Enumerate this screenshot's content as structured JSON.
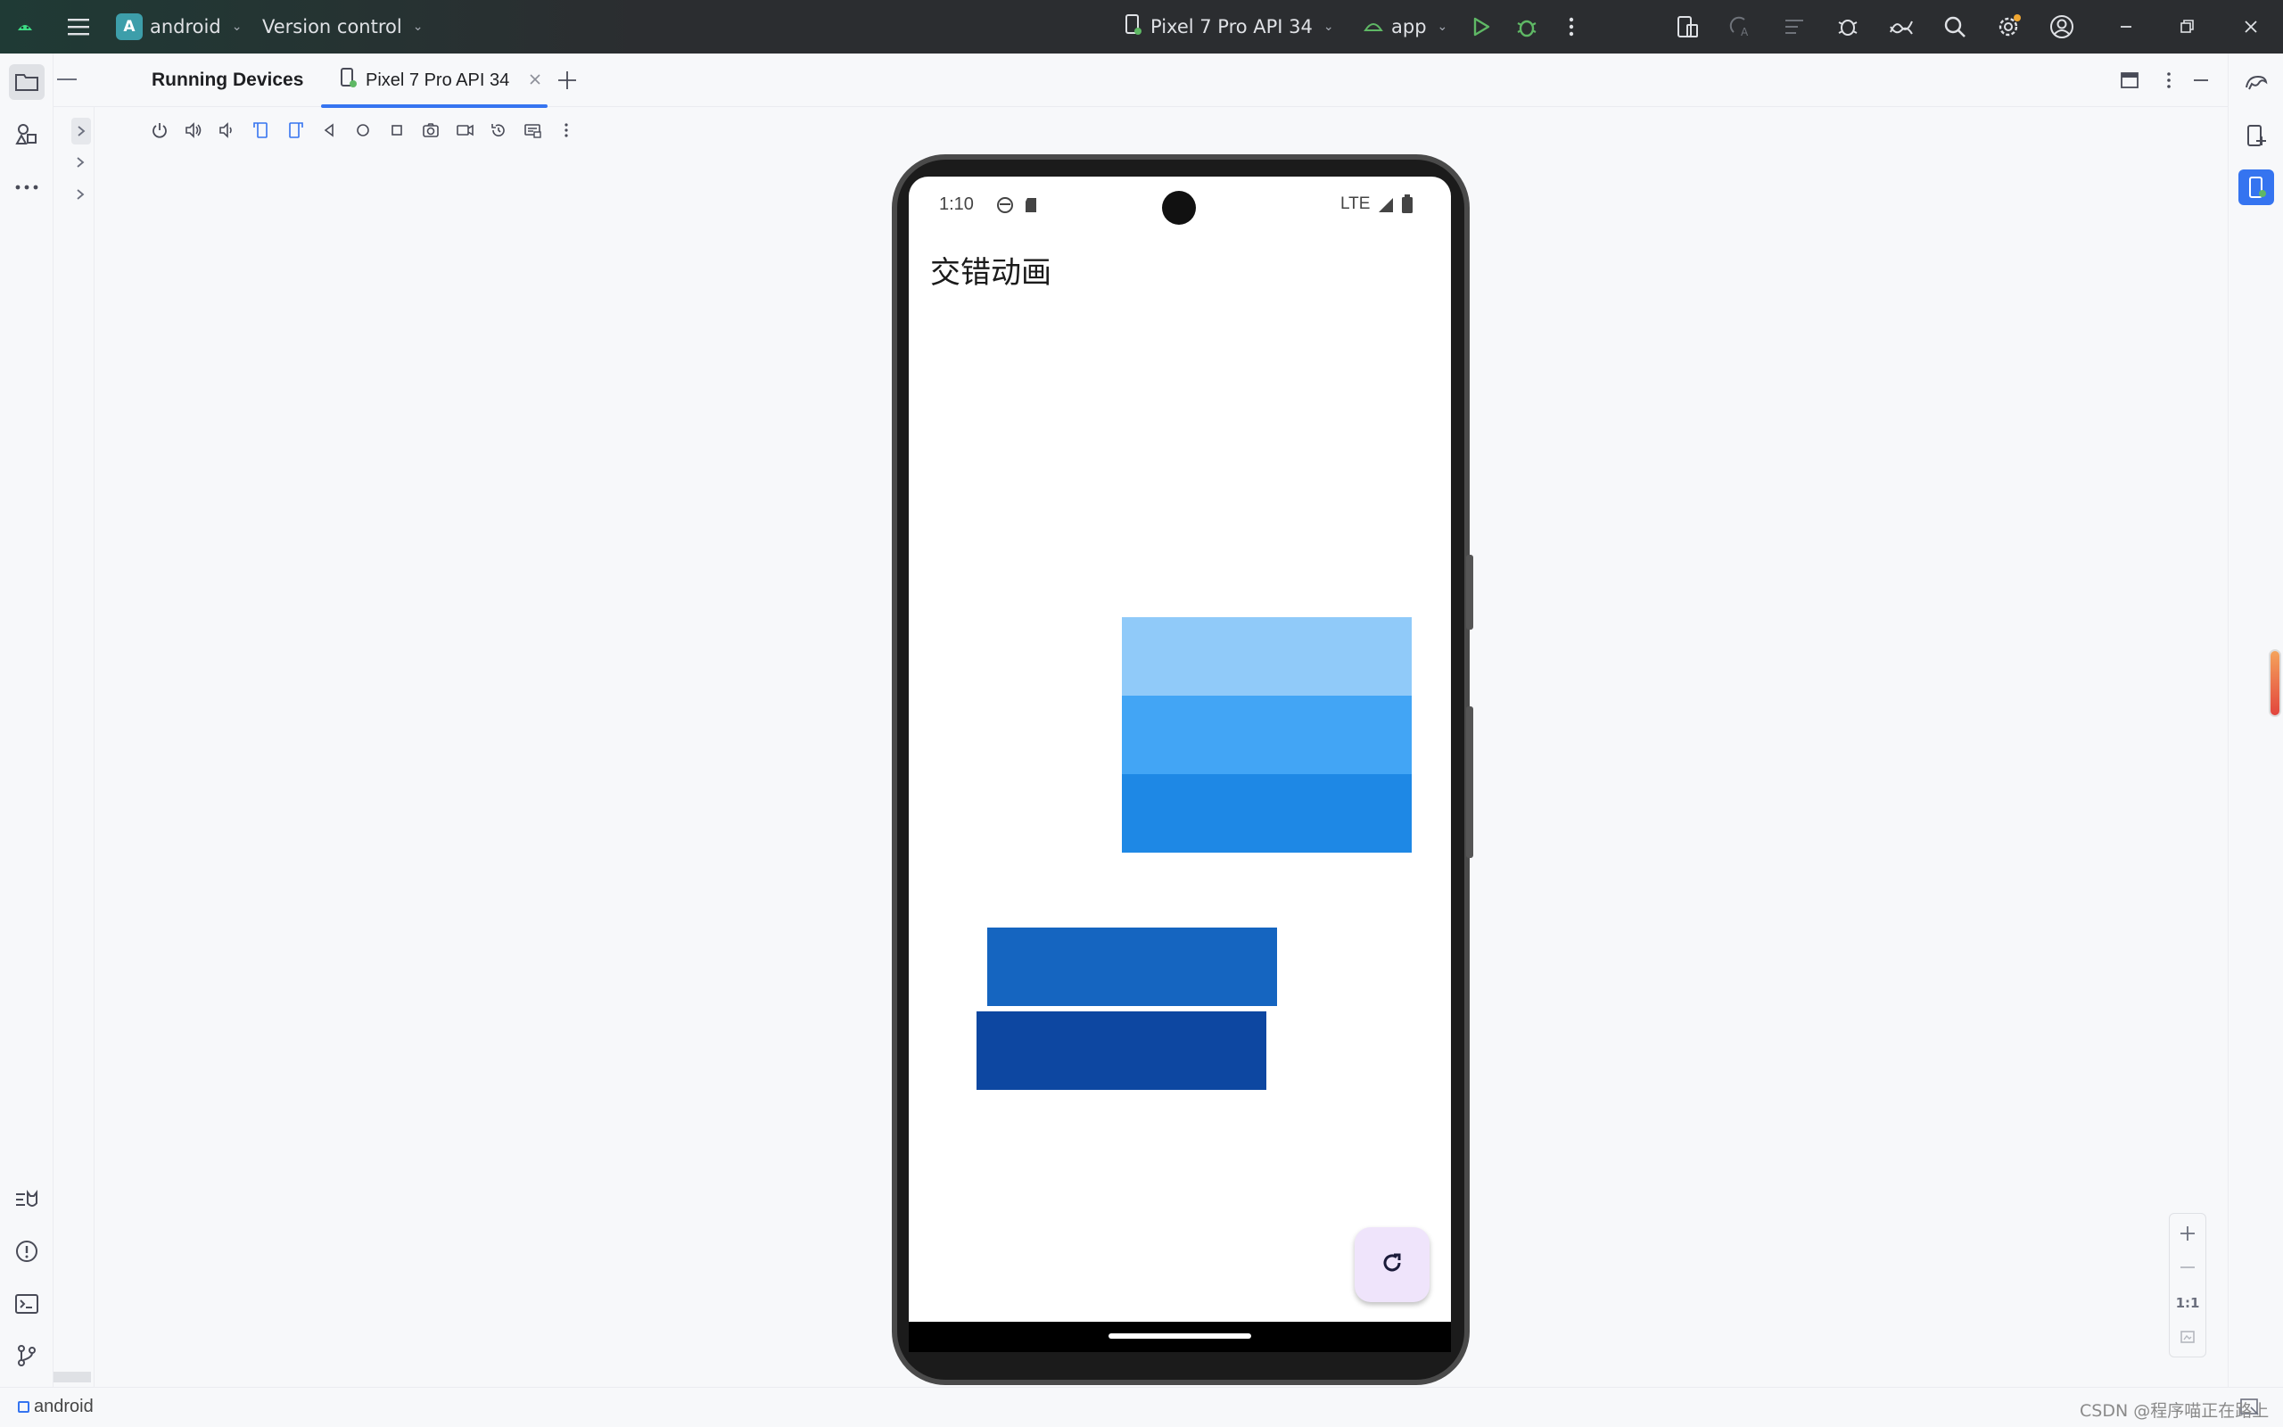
{
  "titlebar": {
    "project_badge": "A",
    "project_name": "android",
    "vcs": "Version control",
    "device": "Pixel 7 Pro API 34",
    "run_config": "app"
  },
  "toolwindow": {
    "title": "Running Devices",
    "tab_label": "Pixel 7 Pro API 34"
  },
  "device_screen": {
    "status_time": "1:10",
    "status_network": "LTE",
    "app_title": "交错动画",
    "boxes": [
      {
        "color": "#90CAF9"
      },
      {
        "color": "#42A5F5"
      },
      {
        "color": "#1E88E5"
      },
      {
        "color": "#1565C0"
      },
      {
        "color": "#0D47A1"
      }
    ],
    "fab_icon": "refresh-icon"
  },
  "zoom": {
    "actual_size_label": "1:1"
  },
  "statusbar": {
    "project_label": "android"
  },
  "watermark": "CSDN @程序喵正在路上",
  "colors": {
    "accent": "#3574f0",
    "run_green": "#5fb865",
    "fab_bg": "#efe4fb"
  }
}
